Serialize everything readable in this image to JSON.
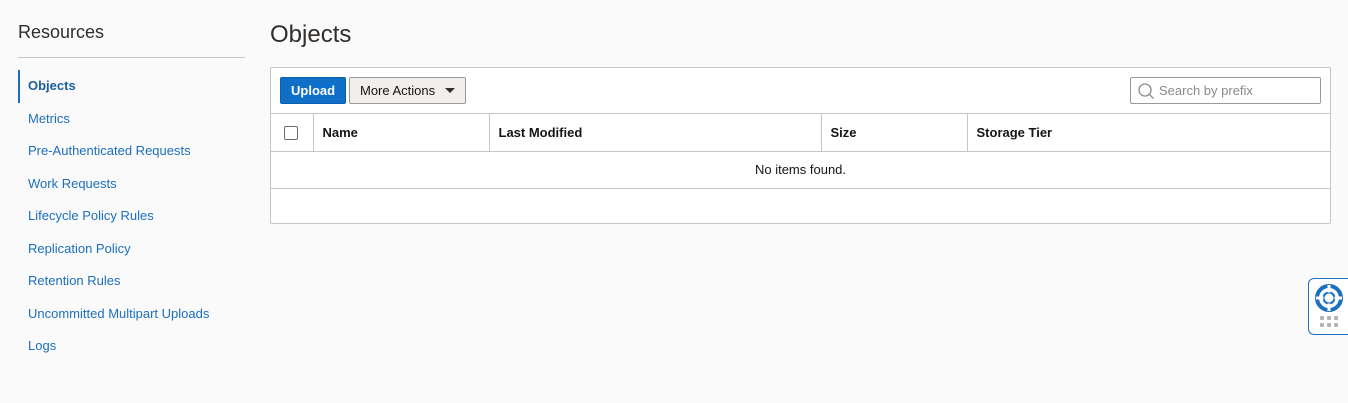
{
  "sidebar": {
    "title": "Resources",
    "items": [
      {
        "label": "Objects",
        "active": true
      },
      {
        "label": "Metrics"
      },
      {
        "label": "Pre-Authenticated Requests"
      },
      {
        "label": "Work Requests"
      },
      {
        "label": "Lifecycle Policy Rules"
      },
      {
        "label": "Replication Policy"
      },
      {
        "label": "Retention Rules"
      },
      {
        "label": "Uncommitted Multipart Uploads"
      },
      {
        "label": "Logs"
      }
    ]
  },
  "main": {
    "title": "Objects",
    "toolbar": {
      "upload_label": "Upload",
      "more_actions_label": "More Actions",
      "search_placeholder": "Search by prefix",
      "search_value": ""
    },
    "table": {
      "columns": [
        "Name",
        "Last Modified",
        "Size",
        "Storage Tier"
      ],
      "empty_message": "No items found."
    }
  },
  "help_widget": {
    "icon": "lifebuoy-icon",
    "handle_icon": "grip-icon"
  },
  "colors": {
    "accent": "#1c6fbf",
    "primary_button": "#0f6fc6",
    "background": "#fafafa"
  }
}
